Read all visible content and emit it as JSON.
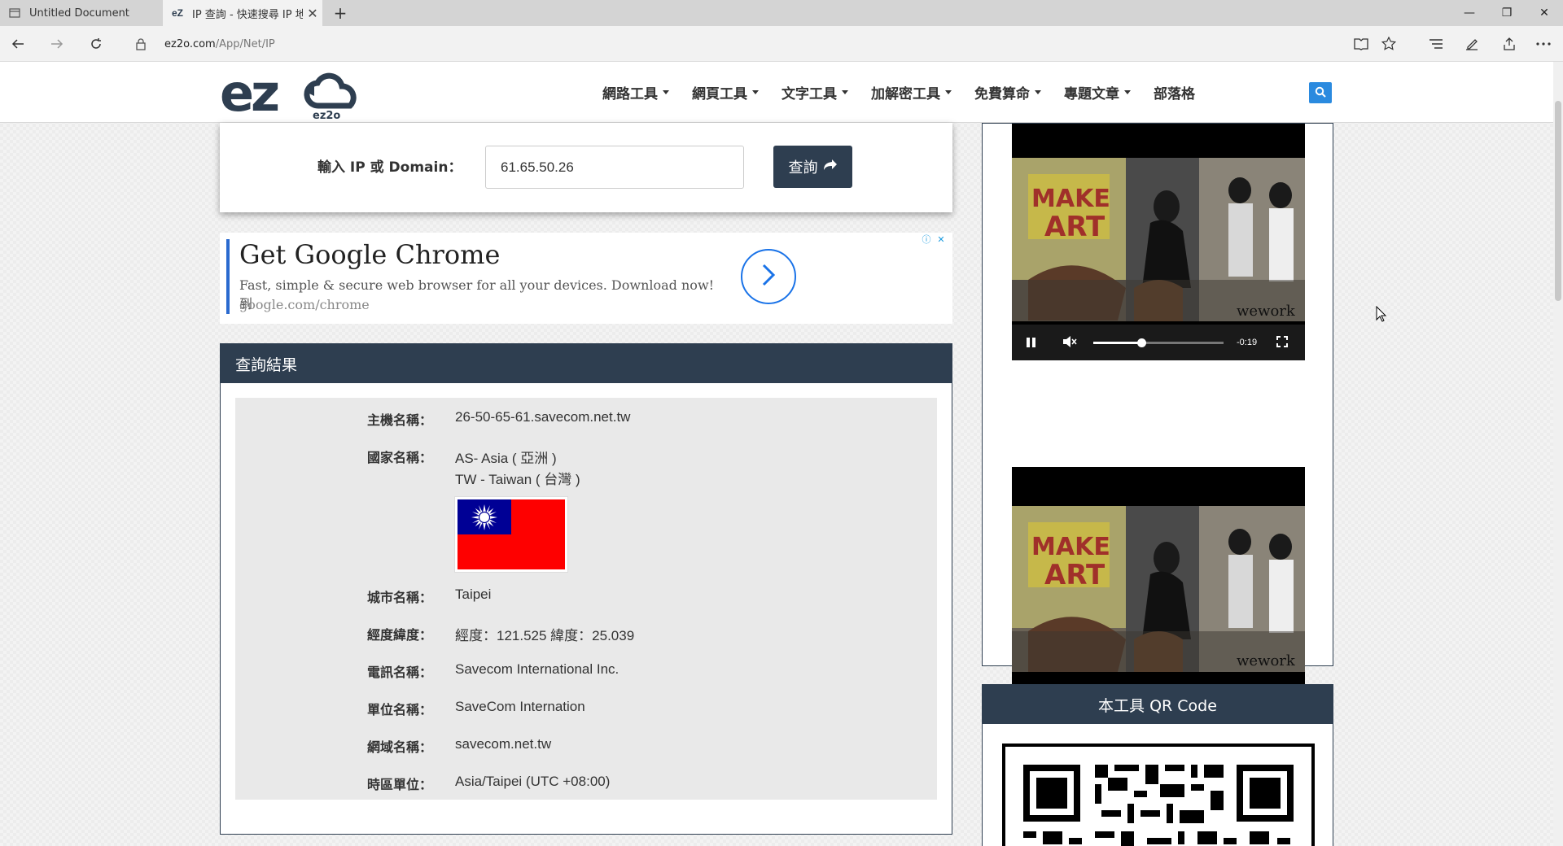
{
  "browser": {
    "tabs": [
      {
        "title": "Untitled Document",
        "active": false
      },
      {
        "title": "IP 查詢 - 快速搜尋 IP 地",
        "active": true
      }
    ],
    "url_host": "ez2o.com",
    "url_path": "/App/Net/IP"
  },
  "site": {
    "logo_text": "ez2o",
    "nav": [
      {
        "label": "網路工具",
        "dropdown": true
      },
      {
        "label": "網頁工具",
        "dropdown": true
      },
      {
        "label": "文字工具",
        "dropdown": true
      },
      {
        "label": "加解密工具",
        "dropdown": true
      },
      {
        "label": "免費算命",
        "dropdown": true
      },
      {
        "label": "專題文章",
        "dropdown": true
      },
      {
        "label": "部落格",
        "dropdown": false
      }
    ],
    "accent_color": "#2e3e50"
  },
  "query": {
    "label": "輸入 IP 或 Domain：",
    "value": "61.65.50.26",
    "button_label": "查詢"
  },
  "ad": {
    "title": "Get Google Chrome",
    "description": "Fast, simple & secure web browser for all your devices. Download now! 到",
    "url": "google.com/chrome"
  },
  "results": {
    "title": "查詢結果",
    "rows": [
      {
        "label": "主機名稱：",
        "value": "26-50-65-61.savecom.net.tw"
      },
      {
        "label": "國家名稱：",
        "value": "AS- Asia ( 亞洲 )",
        "value2": "TW - Taiwan ( 台灣 )"
      },
      {
        "label": "城市名稱：",
        "value": "Taipei"
      },
      {
        "label": "經度緯度：",
        "value": "經度：121.525 緯度：25.039"
      },
      {
        "label": "電訊名稱：",
        "value": "Savecom International Inc."
      },
      {
        "label": "單位名稱：",
        "value": "SaveCom Internation"
      },
      {
        "label": "網域名稱：",
        "value": "savecom.net.tw"
      },
      {
        "label": "時區單位：",
        "value": "Asia/Taipei (UTC +08:00)"
      }
    ]
  },
  "video": {
    "time_remaining": "-0:19",
    "progress": 0.37,
    "watermark": "wework"
  },
  "qr": {
    "title": "本工具 QR Code"
  }
}
